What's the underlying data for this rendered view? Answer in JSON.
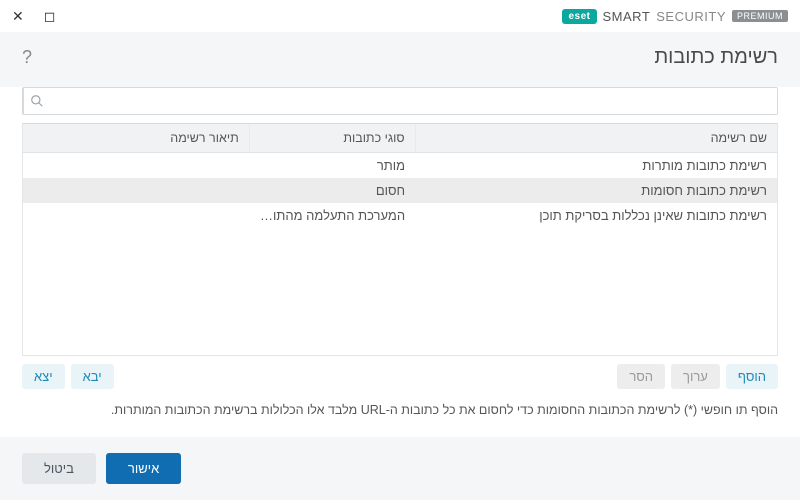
{
  "titlebar": {
    "brand_logo_text": "eset",
    "brand_primary": "SMART",
    "brand_secondary": "SECURITY",
    "brand_badge": "PREMIUM"
  },
  "header": {
    "title": "רשימת כתובות"
  },
  "search": {
    "placeholder": ""
  },
  "table": {
    "columns": {
      "name": "שם רשימה",
      "types": "סוגי כתובות",
      "desc": "תיאור רשימה"
    },
    "rows": [
      {
        "name": "רשימת כתובות מותרות",
        "types": "מותר",
        "desc": ""
      },
      {
        "name": "רשימת כתובות חסומות",
        "types": "חסום",
        "desc": ""
      },
      {
        "name": "רשימת כתובות שאינן נכללות בסריקת תוכן",
        "types": "המערכת התעלמה מהתוכ...",
        "desc": ""
      }
    ],
    "selected_index": 1
  },
  "actions": {
    "add": "הוסף",
    "edit": "ערוך",
    "remove": "הסר",
    "import": "יבא",
    "export": "יצא"
  },
  "hint": "הוסף תו חופשי (*) לרשימת הכתובות החסומות כדי לחסום את כל כתובות ה-URL מלבד אלו הכלולות ברשימת הכתובות המותרות.",
  "footer": {
    "ok": "אישור",
    "cancel": "ביטול"
  }
}
